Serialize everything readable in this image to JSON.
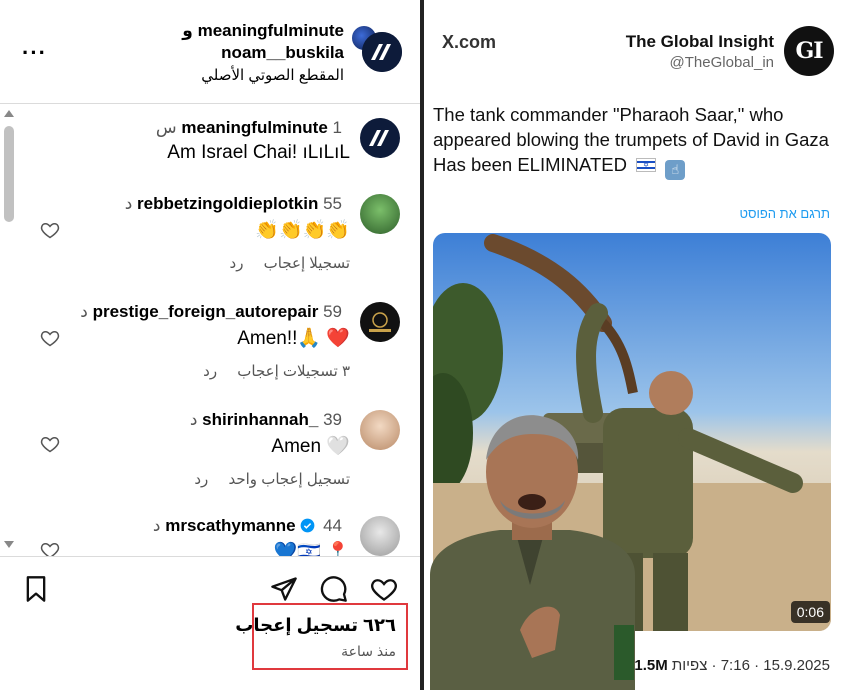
{
  "header": {
    "more_icon": "more-dots-icon",
    "title_user1": "meaningfulminute",
    "title_conj": "و",
    "title_user2": "noam__buskila",
    "audio_label": "المقطع الصوتي الأصلي"
  },
  "comments": [
    {
      "user": "meaningfulminute",
      "time": "1 س",
      "text": "Am Israel Chai! ıLıLıL",
      "likes": "",
      "reply": ""
    },
    {
      "user": "rebbetzingoldieplotkin",
      "time": "55 د",
      "text": "👏👏👏👏",
      "likes": "تسجيلا إعجاب",
      "reply": "رد"
    },
    {
      "user": "prestige_foreign_autorepair",
      "time": "59 د",
      "text": "Amen!!🙏 ❤️",
      "likes": "٣ تسجيلات إعجاب",
      "reply": "رد"
    },
    {
      "user": "shirinhannah_",
      "time": "39 د",
      "text": "Amen 🤍",
      "likes": "تسجيل إعجاب واحد",
      "reply": "رد"
    },
    {
      "user": "mrscathymanne",
      "time": "44 د",
      "text": "💙🇮🇱 📍",
      "likes": "",
      "reply": ""
    }
  ],
  "footer": {
    "likes_count": "٦٢٦ تسجيل إعجاب",
    "posted_ago": "منذ ساعة"
  },
  "tweet": {
    "source": "X.com",
    "account_name": "The Global Insight",
    "account_handle": "@TheGlobal_in",
    "logo_text": "GI",
    "text": "The tank commander \"Pharaoh Saar,\" who appeared blowing the trumpets of David in Gaza Has been ELIMINATED",
    "translate_label": "תרגם את הפוסט",
    "video_duration": "0:06",
    "date": "15.9.2025",
    "time": "7:16",
    "views_count": "1.5M",
    "views_label": "צפיות"
  },
  "colors": {
    "highlight_box": "#e0393e",
    "link_blue": "#1d9bf0",
    "verified_blue": "#0095f6"
  }
}
